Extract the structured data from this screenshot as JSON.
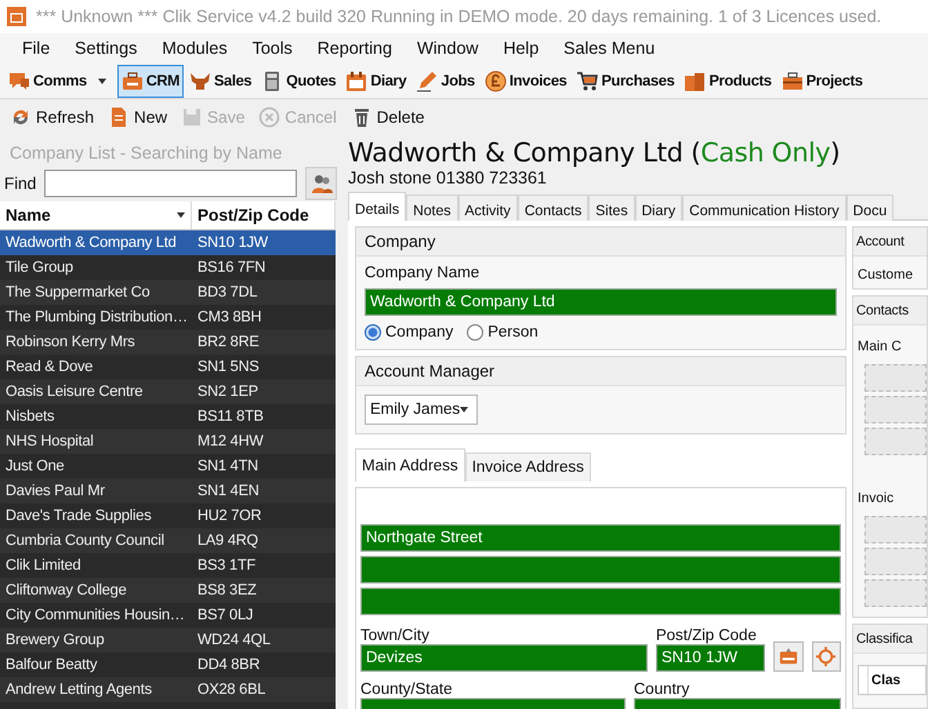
{
  "window": {
    "title": "*** Unknown *** Clik Service v4.2 build 320  Running in DEMO mode. 20 days remaining. 1 of 3 Licences used."
  },
  "menu": [
    "File",
    "Settings",
    "Modules",
    "Tools",
    "Reporting",
    "Window",
    "Help",
    "Sales Menu"
  ],
  "modules": [
    {
      "label": "Comms",
      "selected": false,
      "menu": true
    },
    {
      "label": "CRM",
      "selected": true
    },
    {
      "label": "Sales",
      "selected": false
    },
    {
      "label": "Quotes",
      "selected": false
    },
    {
      "label": "Diary",
      "selected": false
    },
    {
      "label": "Jobs",
      "selected": false
    },
    {
      "label": "Invoices",
      "selected": false
    },
    {
      "label": "Purchases",
      "selected": false
    },
    {
      "label": "Products",
      "selected": false
    },
    {
      "label": "Projects",
      "selected": false
    }
  ],
  "actions": [
    {
      "label": "Refresh",
      "disabled": false
    },
    {
      "label": "New",
      "disabled": false
    },
    {
      "label": "Save",
      "disabled": true
    },
    {
      "label": "Cancel",
      "disabled": true
    },
    {
      "label": "Delete",
      "disabled": false
    }
  ],
  "company_list": {
    "title": "Company List - Searching by Name",
    "find_label": "Find",
    "columns": [
      "Name",
      "Post/Zip Code"
    ],
    "rows": [
      {
        "name": "Wadworth & Company Ltd",
        "postcode": "SN10 1JW",
        "selected": true
      },
      {
        "name": "Tile Group",
        "postcode": "BS16 7FN",
        "selected": false
      },
      {
        "name": "The Suppermarket Co",
        "postcode": "BD3 7DL",
        "selected": false
      },
      {
        "name": "The Plumbing Distribution…",
        "postcode": "CM3 8BH",
        "selected": false
      },
      {
        "name": "Robinson Kerry Mrs",
        "postcode": "BR2 8RE",
        "selected": false
      },
      {
        "name": "Read & Dove",
        "postcode": "SN1  5NS",
        "selected": false
      },
      {
        "name": "Oasis Leisure Centre",
        "postcode": "SN2 1EP",
        "selected": false
      },
      {
        "name": "Nisbets",
        "postcode": "BS11 8TB",
        "selected": false
      },
      {
        "name": "NHS Hospital",
        "postcode": "M12 4HW",
        "selected": false
      },
      {
        "name": "Just One",
        "postcode": "SN1 4TN",
        "selected": false
      },
      {
        "name": "Davies Paul Mr",
        "postcode": "SN1 4EN",
        "selected": false
      },
      {
        "name": "Dave's Trade Supplies",
        "postcode": "HU2 7OR",
        "selected": false
      },
      {
        "name": "Cumbria County Council",
        "postcode": "LA9 4RQ",
        "selected": false
      },
      {
        "name": "Clik Limited",
        "postcode": "BS3 1TF",
        "selected": false
      },
      {
        "name": "Cliftonway College",
        "postcode": "BS8 3EZ",
        "selected": false
      },
      {
        "name": "City Communities Housin…",
        "postcode": "BS7 0LJ",
        "selected": false
      },
      {
        "name": "Brewery Group",
        "postcode": "WD24 4QL",
        "selected": false
      },
      {
        "name": "Balfour Beatty",
        "postcode": "DD4 8BR",
        "selected": false
      },
      {
        "name": "Andrew Letting Agents",
        "postcode": "OX28 6BL",
        "selected": false
      }
    ]
  },
  "detail": {
    "heading": [
      {
        "text": "Wadworth & Company Ltd ("
      },
      {
        "text": "Cash Only",
        "color": "#1e8a1e"
      },
      {
        "text": ")"
      }
    ],
    "subtitle": "Josh stone 01380 723361",
    "tabs": [
      {
        "label": "Details",
        "selected": true
      },
      {
        "label": "Notes",
        "selected": false
      },
      {
        "label": "Activity",
        "selected": false
      },
      {
        "label": "Contacts",
        "selected": false
      },
      {
        "label": "Sites",
        "selected": false
      },
      {
        "label": "Diary",
        "selected": false
      },
      {
        "label": "Communication History",
        "selected": false
      },
      {
        "label": "Docu",
        "selected": false
      }
    ],
    "company": {
      "title": "Company",
      "name_label": "Company Name",
      "name": "Wadworth & Company Ltd",
      "types": [
        {
          "label": "Company",
          "selected": true
        },
        {
          "label": "Person",
          "selected": false
        }
      ]
    },
    "account_manager": {
      "title": "Account Manager",
      "value": "Emily James"
    },
    "address": {
      "tabs": [
        {
          "label": "Main Address",
          "selected": true
        },
        {
          "label": "Invoice Address",
          "selected": false
        }
      ],
      "lines": [
        {
          "kind": "text",
          "value": "Northgate Street"
        },
        {
          "kind": "blank"
        },
        {
          "kind": "blank"
        }
      ],
      "town_label": "Town/City",
      "town": "Devizes",
      "postcode_label": "Post/Zip Code",
      "postcode": "SN10 1JW",
      "county_label": "County/State",
      "country_label": "Country"
    },
    "account": {
      "title": "Account",
      "label": "Custome"
    },
    "contacts": {
      "title": "Contacts",
      "main_label": "Main C",
      "invoice_label": "Invoic"
    },
    "classification": {
      "title": "Classifica",
      "column": "Clas"
    }
  }
}
